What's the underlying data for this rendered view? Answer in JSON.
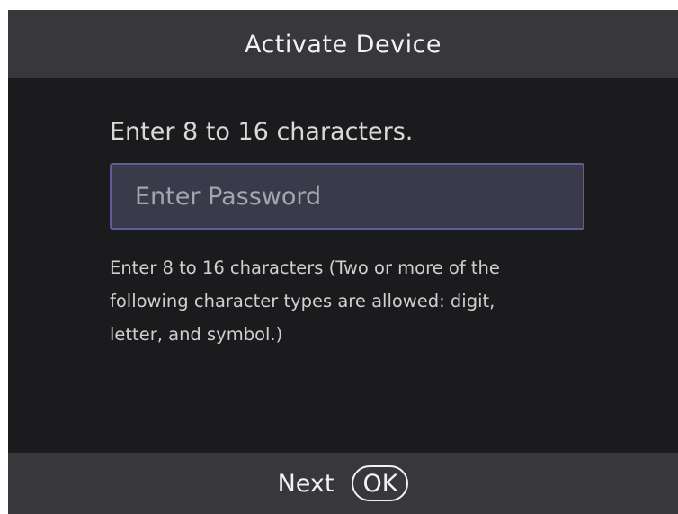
{
  "header": {
    "title": "Activate Device"
  },
  "main": {
    "prompt": "Enter 8 to 16 characters.",
    "password_placeholder": "Enter Password",
    "hint_lines": [
      "Enter 8 to 16 characters (Two or more of the",
      "following character types are allowed: digit,",
      "letter, and symbol.)"
    ]
  },
  "footer": {
    "next_label": "Next",
    "ok_key_label": "OK"
  },
  "colors": {
    "background": "#1b1b1d",
    "bar": "#38383c",
    "field_background": "#3b3a4a",
    "field_border": "#5d5d9a"
  }
}
